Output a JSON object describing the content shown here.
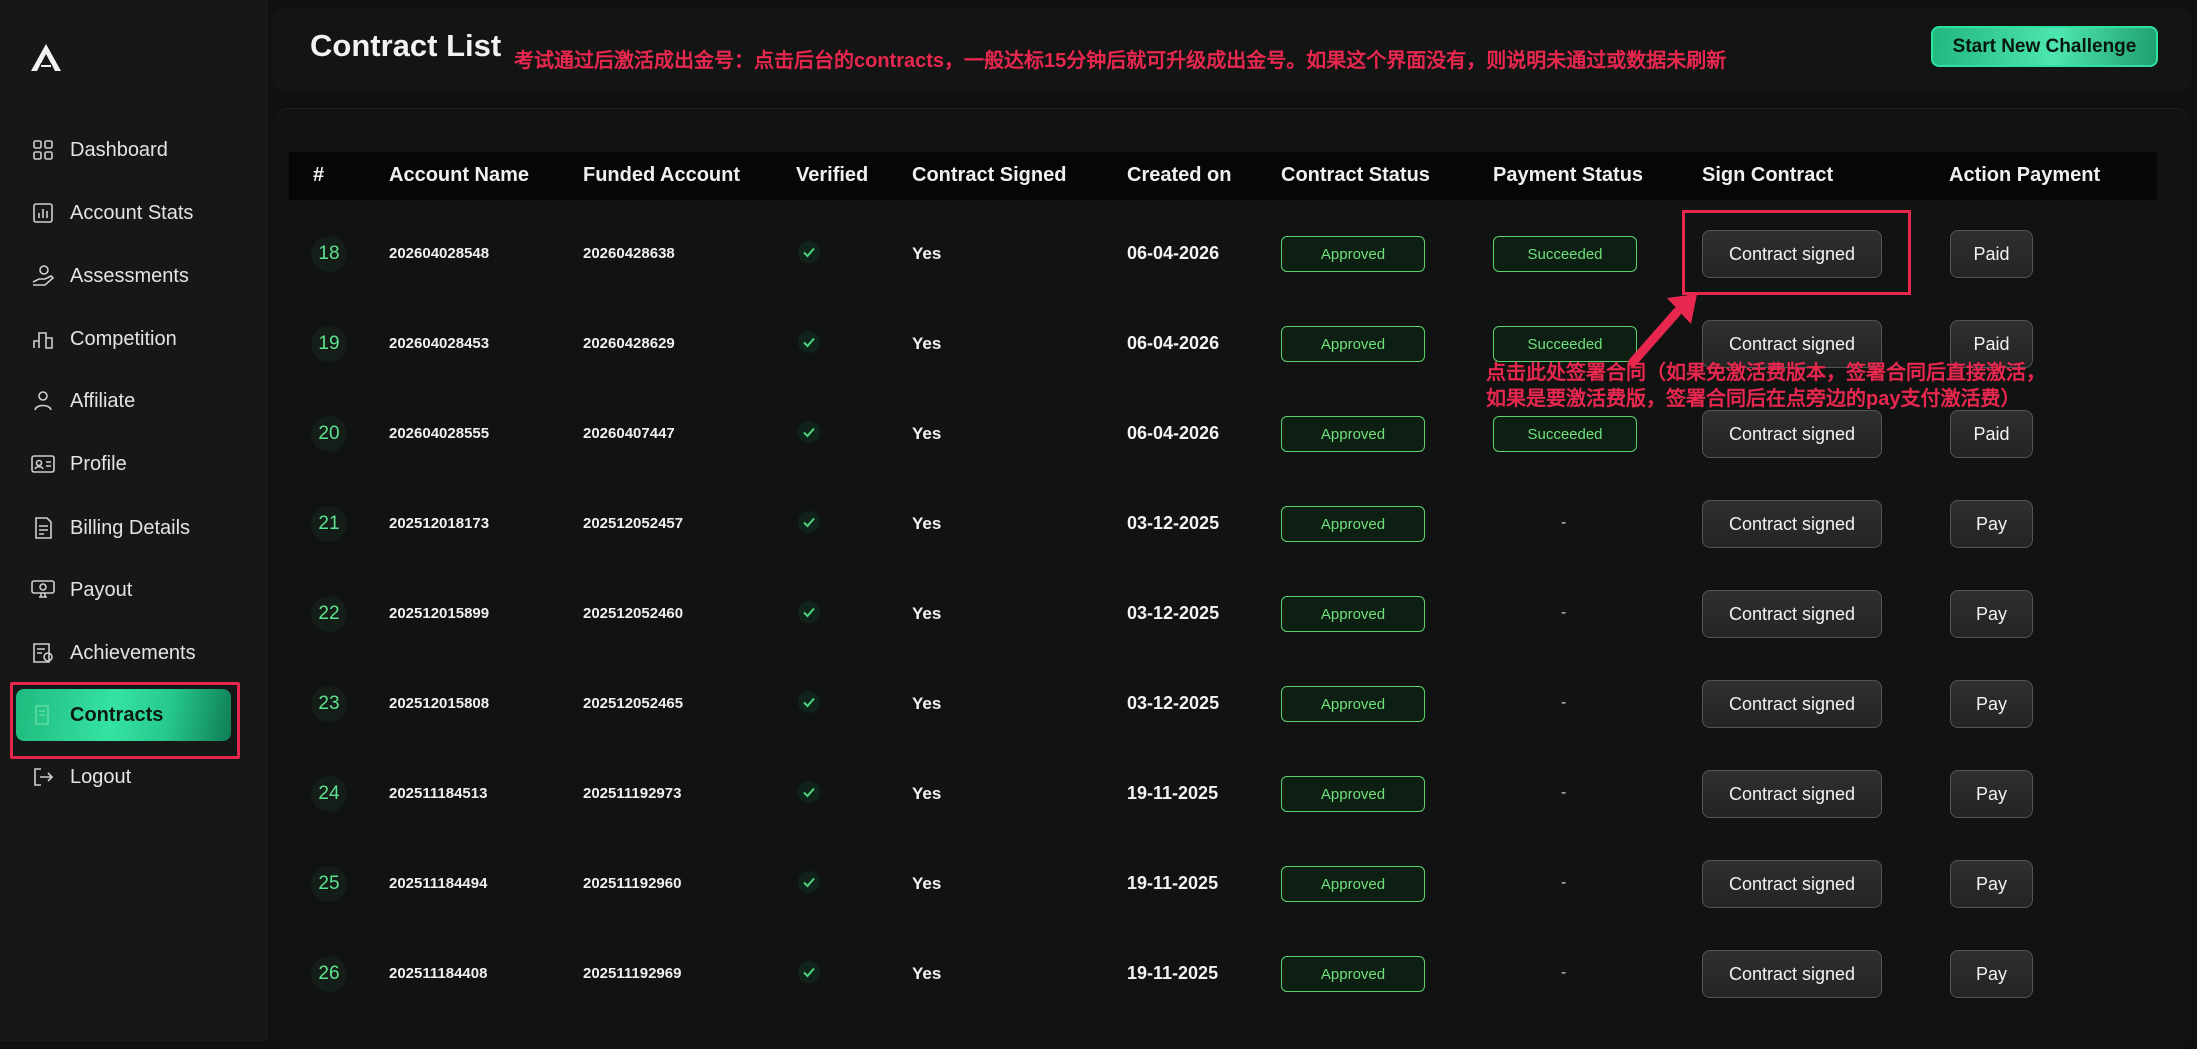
{
  "header": {
    "title": "Contract List",
    "annotation": "考试通过后激活成出金号：点击后台的contracts，一般达标15分钟后就可升级成出金号。如果这个界面没有，则说明未通过或数据未刷新",
    "start_button": "Start New Challenge"
  },
  "sidebar": {
    "items": [
      {
        "label": "Dashboard",
        "icon": "grid-icon"
      },
      {
        "label": "Account Stats",
        "icon": "bar-chart-icon"
      },
      {
        "label": "Assessments",
        "icon": "coins-hand-icon"
      },
      {
        "label": "Competition",
        "icon": "podium-icon"
      },
      {
        "label": "Affiliate",
        "icon": "people-icon"
      },
      {
        "label": "Profile",
        "icon": "id-card-icon"
      },
      {
        "label": "Billing Details",
        "icon": "document-icon"
      },
      {
        "label": "Payout",
        "icon": "cash-icon"
      },
      {
        "label": "Achievements",
        "icon": "badge-icon"
      },
      {
        "label": "Contracts",
        "icon": "contract-icon",
        "active": true
      },
      {
        "label": "Logout",
        "icon": "logout-icon"
      }
    ]
  },
  "table": {
    "columns": [
      "#",
      "Account Name",
      "Funded Account",
      "Verified",
      "Contract Signed",
      "Created on",
      "Contract Status",
      "Payment Status",
      "Sign Contract",
      "Action Payment"
    ],
    "rows": [
      {
        "index": "18",
        "account": "202604028548",
        "funded": "20260428638",
        "signed": "Yes",
        "created": "06-04-2026",
        "status": "Approved",
        "payment": "Succeeded",
        "sign": "Contract signed",
        "action": "Paid"
      },
      {
        "index": "19",
        "account": "202604028453",
        "funded": "20260428629",
        "signed": "Yes",
        "created": "06-04-2026",
        "status": "Approved",
        "payment": "Succeeded",
        "sign": "Contract signed",
        "action": "Paid"
      },
      {
        "index": "20",
        "account": "202604028555",
        "funded": "20260407447",
        "signed": "Yes",
        "created": "06-04-2026",
        "status": "Approved",
        "payment": "Succeeded",
        "sign": "Contract signed",
        "action": "Paid"
      },
      {
        "index": "21",
        "account": "202512018173",
        "funded": "202512052457",
        "signed": "Yes",
        "created": "03-12-2025",
        "status": "Approved",
        "payment": "-",
        "sign": "Contract signed",
        "action": "Pay"
      },
      {
        "index": "22",
        "account": "202512015899",
        "funded": "202512052460",
        "signed": "Yes",
        "created": "03-12-2025",
        "status": "Approved",
        "payment": "-",
        "sign": "Contract signed",
        "action": "Pay"
      },
      {
        "index": "23",
        "account": "202512015808",
        "funded": "202512052465",
        "signed": "Yes",
        "created": "03-12-2025",
        "status": "Approved",
        "payment": "-",
        "sign": "Contract signed",
        "action": "Pay"
      },
      {
        "index": "24",
        "account": "202511184513",
        "funded": "202511192973",
        "signed": "Yes",
        "created": "19-11-2025",
        "status": "Approved",
        "payment": "-",
        "sign": "Contract signed",
        "action": "Pay"
      },
      {
        "index": "25",
        "account": "202511184494",
        "funded": "202511192960",
        "signed": "Yes",
        "created": "19-11-2025",
        "status": "Approved",
        "payment": "-",
        "sign": "Contract signed",
        "action": "Pay"
      },
      {
        "index": "26",
        "account": "202511184408",
        "funded": "202511192969",
        "signed": "Yes",
        "created": "19-11-2025",
        "status": "Approved",
        "payment": "-",
        "sign": "Contract signed",
        "action": "Pay"
      }
    ]
  },
  "annotation_sign": [
    "点击此处签署合同（如果免激活费版本，签署合同后直接激活，",
    "如果是要激活费版，签署合同后在点旁边的pay支付激活费）"
  ],
  "colors": {
    "accent": "#2fe0a0",
    "annotation": "#e8274f",
    "approved": "#6fe07b",
    "background": "#0f1010"
  }
}
